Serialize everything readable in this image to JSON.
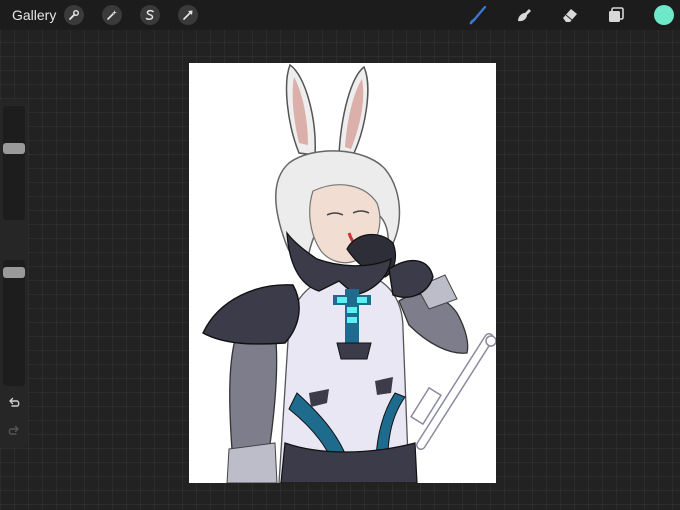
{
  "toolbar": {
    "gallery_label": "Gallery",
    "left_tools": [
      {
        "name": "actions",
        "icon": "wrench-icon"
      },
      {
        "name": "adjustments",
        "icon": "magic-wand-icon"
      },
      {
        "name": "selection",
        "icon": "selection-s-icon"
      },
      {
        "name": "transform",
        "icon": "arrow-cursor-icon"
      }
    ],
    "right_tools": [
      {
        "name": "brush",
        "icon": "brush-icon",
        "active": true
      },
      {
        "name": "smudge",
        "icon": "smudge-icon",
        "active": false
      },
      {
        "name": "eraser",
        "icon": "eraser-icon",
        "active": false
      },
      {
        "name": "layers",
        "icon": "layers-icon",
        "active": false
      }
    ],
    "current_color": "#6ee8c8",
    "active_tool_color": "#3a7bd5"
  },
  "sidebar": {
    "brush_size_level": 0.64,
    "opacity_level": 0.94,
    "modify_icon": "square-modify-icon",
    "undo_icon": "undo-arrow-icon",
    "redo_icon": "redo-arrow-icon",
    "redo_enabled": false
  },
  "canvas": {
    "background": "#ffffff",
    "accent_glow": "#5cf0f0",
    "accent_blue": "#1e6b8e",
    "armor_dark": "#3b3b4a",
    "robe_light": "#e8e7f3"
  }
}
